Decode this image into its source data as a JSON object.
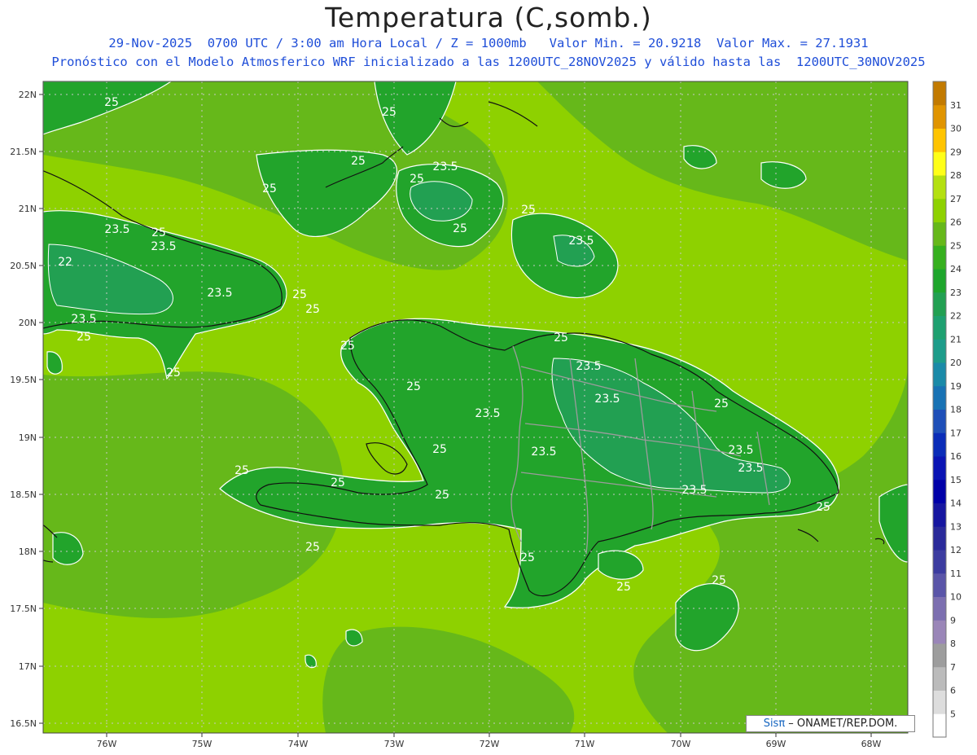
{
  "header": {
    "title": "Temperatura (C,somb.)",
    "subtitle_1": "29-Nov-2025  0700 UTC / 3:00 am Hora Local / Z = 1000mb   Valor Min. = 20.9218  Valor Max. = 27.1931",
    "subtitle_2": "Pronóstico con el Modelo Atmosferico WRF inicializado a las 1200UTC_28NOV2025 y válido hasta las  1200UTC_30NOV2025"
  },
  "map": {
    "lat_labels": [
      "22N",
      "21.5N",
      "21N",
      "20.5N",
      "20N",
      "19.5N",
      "19N",
      "18.5N",
      "18N",
      "17.5N",
      "17N",
      "16.5N"
    ],
    "lon_labels": [
      "76W",
      "75W",
      "74W",
      "73W",
      "72W",
      "71W",
      "70W",
      "69W",
      "68W"
    ],
    "contour_labels": [
      "25",
      "23.5",
      "22"
    ],
    "colors": {
      "base": "#8ed100",
      "mid": "#66b81a",
      "land": "#22a42b",
      "cool": "#22a052"
    }
  },
  "colorbar": {
    "levels": [
      5,
      6,
      7,
      8,
      9,
      10,
      11,
      12,
      13,
      14,
      15,
      16,
      17,
      18,
      19,
      20,
      21,
      22,
      23,
      24,
      25,
      26,
      27,
      28,
      29,
      30,
      31
    ],
    "colors": [
      "#ffffff",
      "#dddddd",
      "#bbbbbb",
      "#9d9d9d",
      "#9a86b8",
      "#7c6fb0",
      "#5a55a8",
      "#3c3ca0",
      "#2a2a9a",
      "#1616a0",
      "#0000a8",
      "#0a14b4",
      "#0a2cb8",
      "#1e4fb8",
      "#1872b4",
      "#1a8aa8",
      "#1d9c8a",
      "#1ea070",
      "#22a052",
      "#1ea62c",
      "#36b01e",
      "#66b81a",
      "#8ed100",
      "#b4e010",
      "#ffff18",
      "#ffc400",
      "#e09400",
      "#c27a00"
    ]
  },
  "credit": {
    "brand": "Sisπ",
    "text": " – ONAMET/REP.DOM."
  }
}
